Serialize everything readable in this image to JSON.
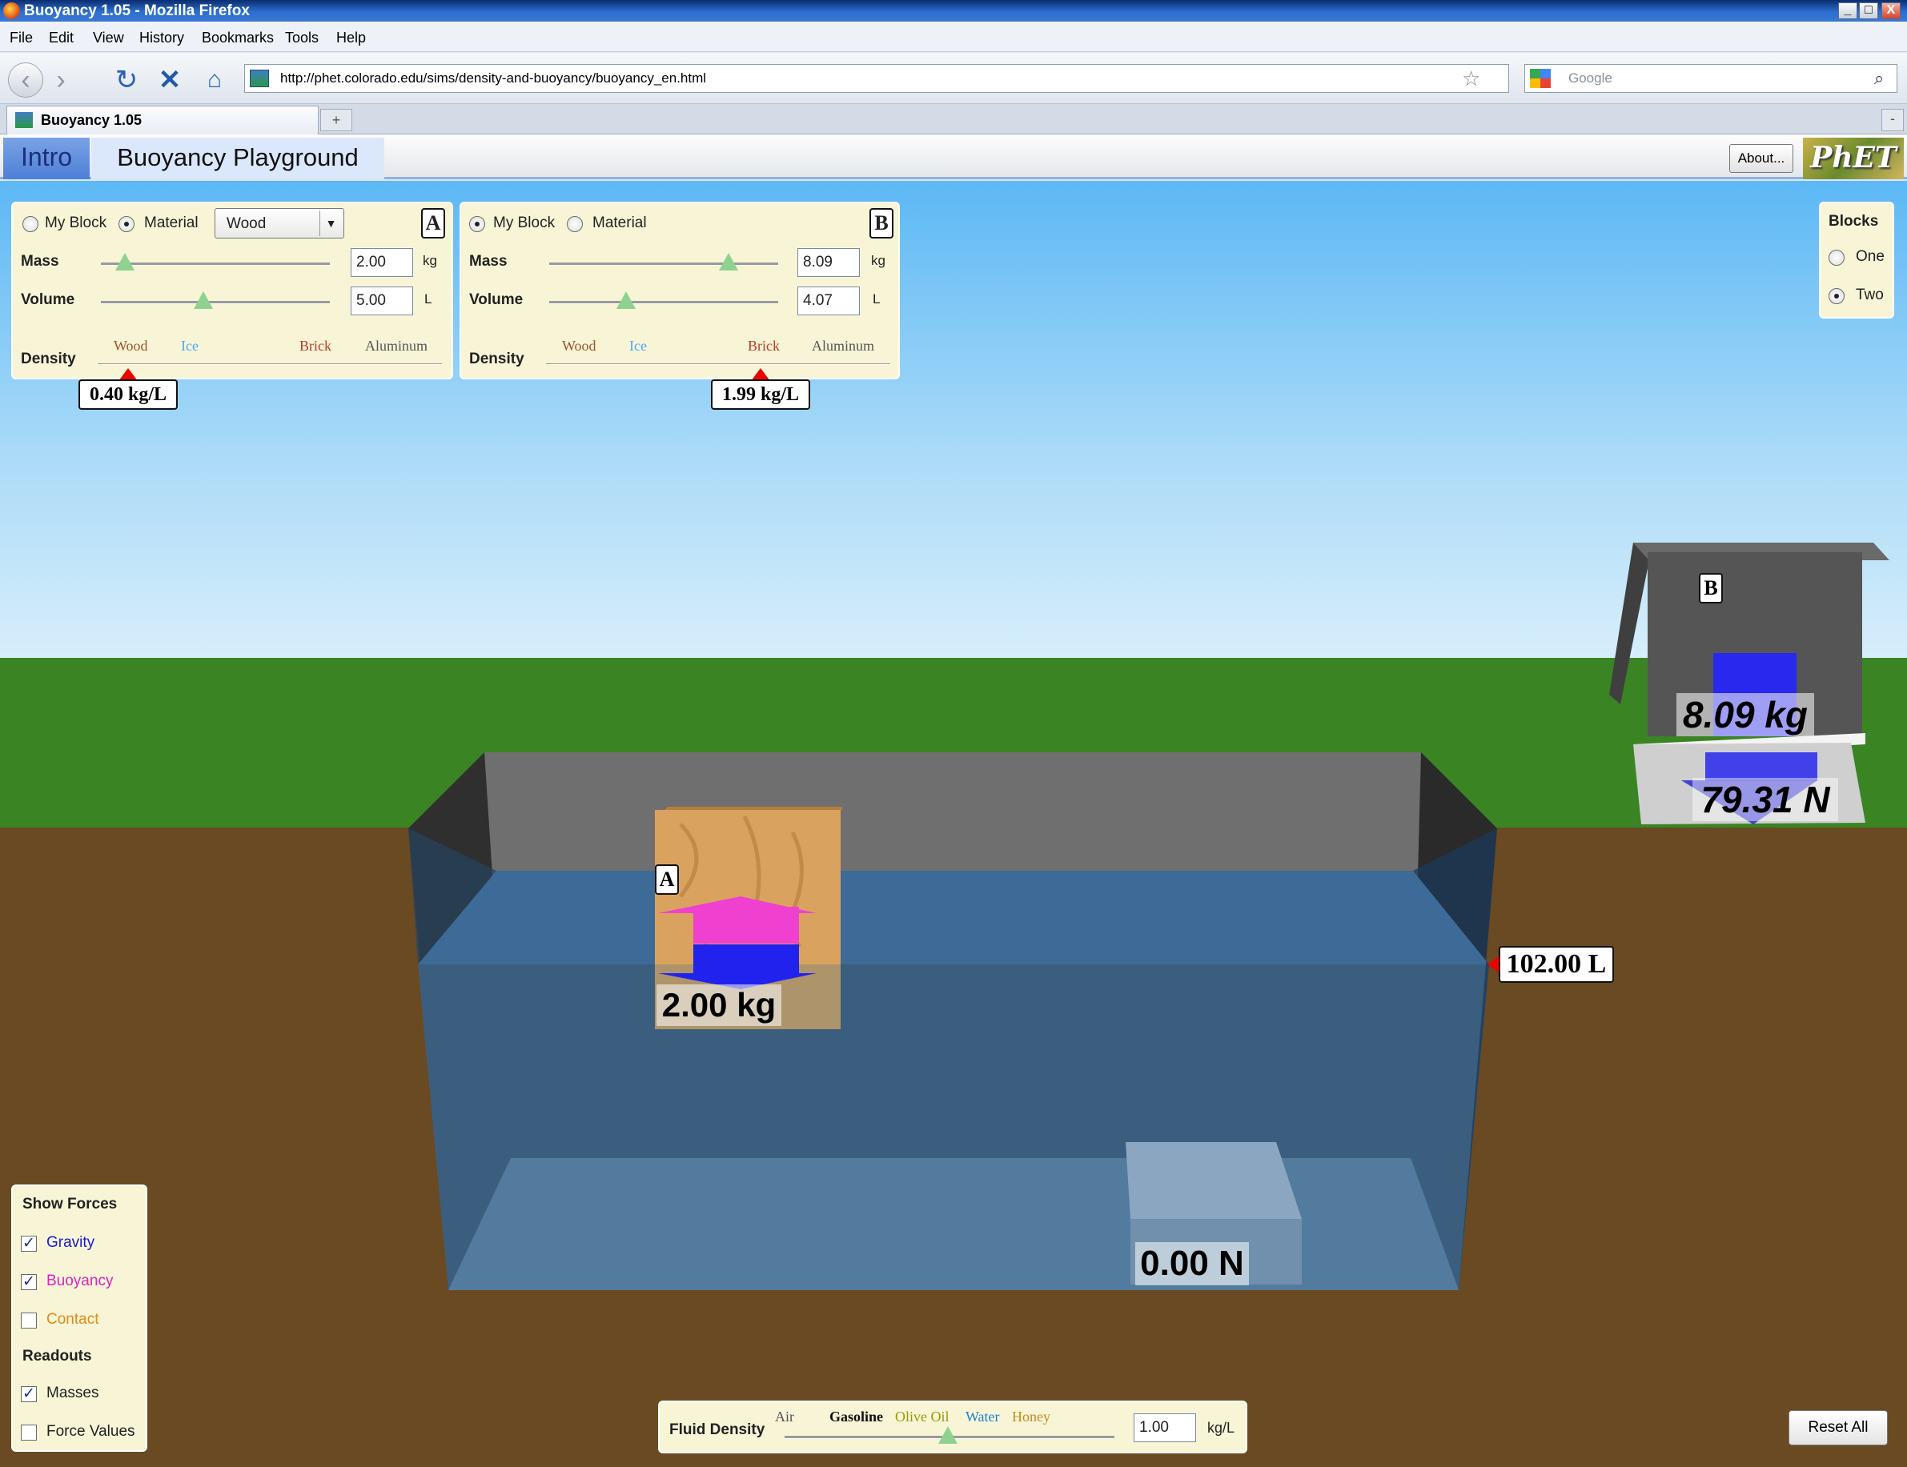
{
  "window": {
    "title": "Buoyancy 1.05 - Mozilla Firefox",
    "min_glyph": "_",
    "max_glyph": "□",
    "close_glyph": "X"
  },
  "menu": [
    "File",
    "Edit",
    "View",
    "History",
    "Bookmarks",
    "Tools",
    "Help"
  ],
  "browser": {
    "url": "http://phet.colorado.edu/sims/density-and-buoyancy/buoyancy_en.html",
    "search_placeholder": "Google",
    "tab_title": "Buoyancy 1.05",
    "new_tab_glyph": "+",
    "tab_menu_glyph": "-"
  },
  "sim": {
    "tabs": {
      "intro": "Intro",
      "playground": "Buoyancy Playground"
    },
    "about_label": "About...",
    "logo": "PhET"
  },
  "blockA": {
    "label": "A",
    "my_block": "My Block",
    "material": "Material",
    "material_selected": "Wood",
    "mode": "material",
    "mass_label": "Mass",
    "mass_value": "2.00",
    "mass_unit": "kg",
    "volume_label": "Volume",
    "volume_value": "5.00",
    "volume_unit": "L",
    "density_label": "Density",
    "density_readout": "0.40 kg/L",
    "scene_mass": "2.00 kg"
  },
  "blockB": {
    "label": "B",
    "my_block": "My Block",
    "material": "Material",
    "mode": "my_block",
    "mass_label": "Mass",
    "mass_value": "8.09",
    "mass_unit": "kg",
    "volume_label": "Volume",
    "volume_value": "4.07",
    "volume_unit": "L",
    "density_label": "Density",
    "density_readout": "1.99 kg/L",
    "scene_mass": "8.09 kg",
    "scale_force": "79.31 N"
  },
  "density_scale": {
    "wood": "Wood",
    "ice": "Ice",
    "brick": "Brick",
    "aluminum": "Aluminum",
    "colors": {
      "wood": "#a0522d",
      "ice": "#4da6ff",
      "brick": "#c0392b",
      "aluminum": "#555555"
    }
  },
  "blocks_panel": {
    "title": "Blocks",
    "one": "One",
    "two": "Two",
    "selected": "Two"
  },
  "pool": {
    "volume_readout": "102.00 L",
    "scale_force": "0.00 N"
  },
  "show_forces": {
    "title": "Show Forces",
    "gravity": "Gravity",
    "gravity_checked": true,
    "buoyancy": "Buoyancy",
    "buoyancy_checked": true,
    "contact": "Contact",
    "contact_checked": false,
    "readouts_title": "Readouts",
    "masses": "Masses",
    "masses_checked": true,
    "force_values": "Force Values",
    "force_values_checked": false,
    "check_glyph": "✓",
    "colors": {
      "gravity": "#1a1acc",
      "buoyancy": "#e020c0",
      "contact": "#e08a1a"
    }
  },
  "fluid": {
    "title": "Fluid Density",
    "air": "Air",
    "gasoline": "Gasoline",
    "olive_oil": "Olive Oil",
    "water": "Water",
    "honey": "Honey",
    "value": "1.00",
    "unit": "kg/L",
    "colors": {
      "gasoline": "#111111",
      "olive_oil": "#9a9a00",
      "water": "#1a7fd1",
      "honey": "#c78a1a"
    }
  },
  "reset_all": "Reset All"
}
